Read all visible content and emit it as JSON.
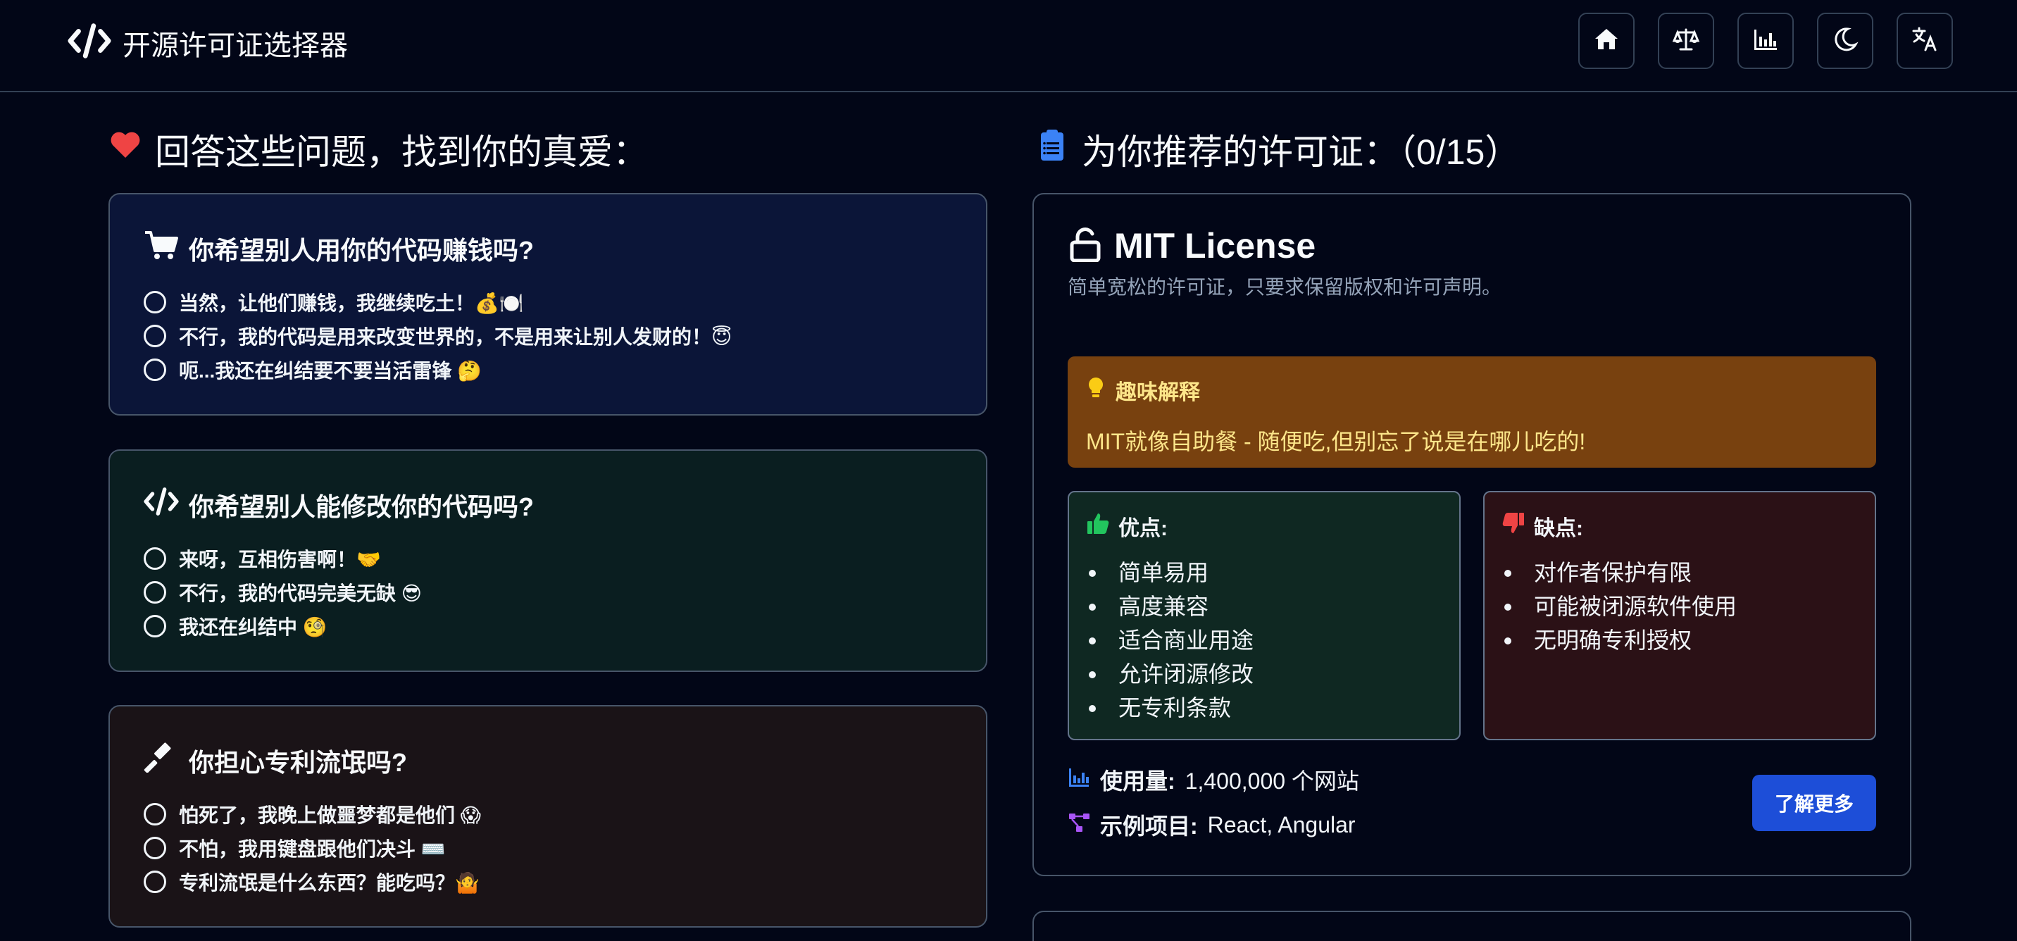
{
  "header": {
    "title": "开源许可证选择器",
    "logo_icon": "code-icon",
    "nav": [
      {
        "name": "home",
        "icon": "home-icon"
      },
      {
        "name": "compare",
        "icon": "scale-icon"
      },
      {
        "name": "stats",
        "icon": "chart-icon"
      },
      {
        "name": "theme",
        "icon": "moon-icon"
      },
      {
        "name": "language",
        "icon": "translate-icon"
      }
    ]
  },
  "left": {
    "title": "回答这些问题，找到你的真爱：",
    "title_icon": "heart-icon",
    "questions": [
      {
        "icon": "cart-icon",
        "title": "你希望别人用你的代码赚钱吗?",
        "options": [
          "当然，让他们赚钱，我继续吃土！💰🍽️",
          "不行，我的代码是用来改变世界的，不是用来让别人发财的！😇",
          "呃...我还在纠结要不要当活雷锋 🤔"
        ]
      },
      {
        "icon": "code-icon",
        "title": "你希望别人能修改你的代码吗?",
        "options": [
          "来呀，互相伤害啊！🤝",
          "不行，我的代码完美无缺 😎",
          "我还在纠结中 🧐"
        ]
      },
      {
        "icon": "gavel-icon",
        "title": "你担心专利流氓吗?",
        "options": [
          "怕死了，我晚上做噩梦都是他们 😱",
          "不怕，我用键盘跟他们决斗 ⌨️",
          "专利流氓是什么东西？能吃吗？🤷"
        ]
      }
    ]
  },
  "right": {
    "title": "为你推荐的许可证：（0/15）",
    "title_icon": "clipboard-icon",
    "license": {
      "icon": "unlock-icon",
      "name": "MIT License",
      "description": "简单宽松的许可证，只要求保留版权和许可声明。",
      "fun_title": "趣味解释",
      "fun_text": "MIT就像自助餐 - 随便吃,但别忘了说是在哪儿吃的!",
      "pros_title": "优点:",
      "pros": [
        "简单易用",
        "高度兼容",
        "适合商业用途",
        "允许闭源修改",
        "无专利条款"
      ],
      "cons_title": "缺点:",
      "cons": [
        "对作者保护有限",
        "可能被闭源软件使用",
        "无明确专利授权"
      ],
      "usage_label": "使用量:",
      "usage_value": "1,400,000 个网站",
      "projects_label": "示例项目:",
      "projects_value": "React, Angular",
      "more_button": "了解更多"
    }
  },
  "colors": {
    "background": "#020617",
    "accent_blue": "#1d4ed8",
    "heart_red": "#ef4444",
    "fun_bg": "#78410f",
    "fun_text": "#fde68a",
    "pros_green": "#22c55e",
    "cons_red": "#ef4444"
  }
}
